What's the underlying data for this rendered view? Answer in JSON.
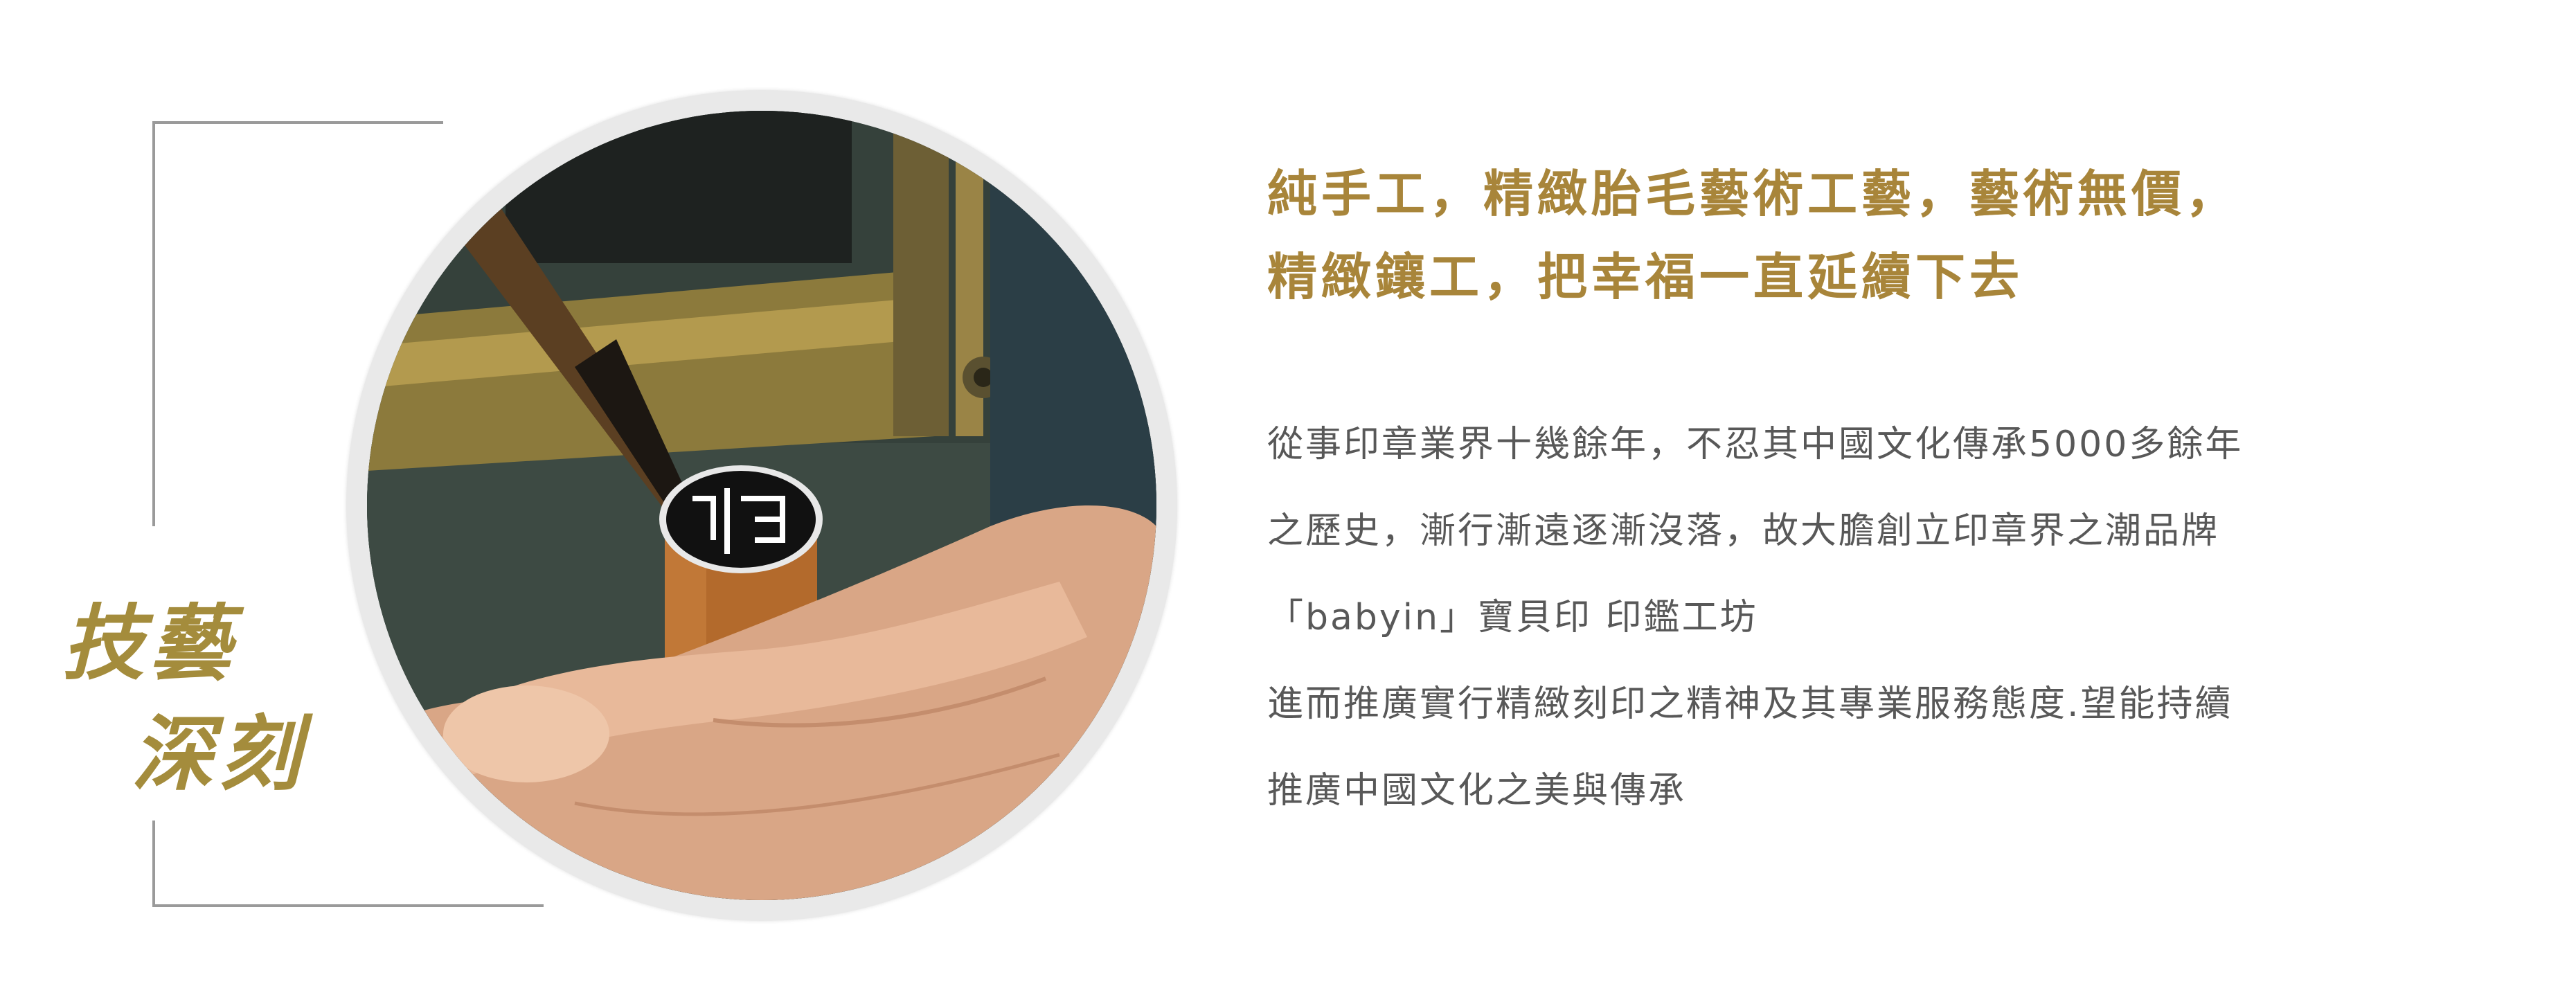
{
  "title": {
    "line1": "技藝",
    "line2": "深刻"
  },
  "headline": {
    "line1": "純手工，精緻胎毛藝術工藝，藝術無價，",
    "line2": "精緻鑲工，把幸福一直延續下去"
  },
  "body": {
    "line1": "從事印章業界十幾餘年，不忍其中國文化傳承5000多餘年",
    "line2": "之歷史，漸行漸遠逐漸沒落，故大膽創立印章界之潮品牌",
    "line3": "「babyin」寶貝印 印鑑工坊",
    "line4": "進而推廣實行精緻刻印之精神及其專業服務態度.望能持續",
    "line5": "推廣中國文化之美與傳承"
  },
  "photo": {
    "subject": "hand-holding-seal-with-brush"
  },
  "colors": {
    "accent": "#a8853a",
    "title": "#a48c3c",
    "text": "#585858",
    "frame": "#9a9a9a"
  }
}
